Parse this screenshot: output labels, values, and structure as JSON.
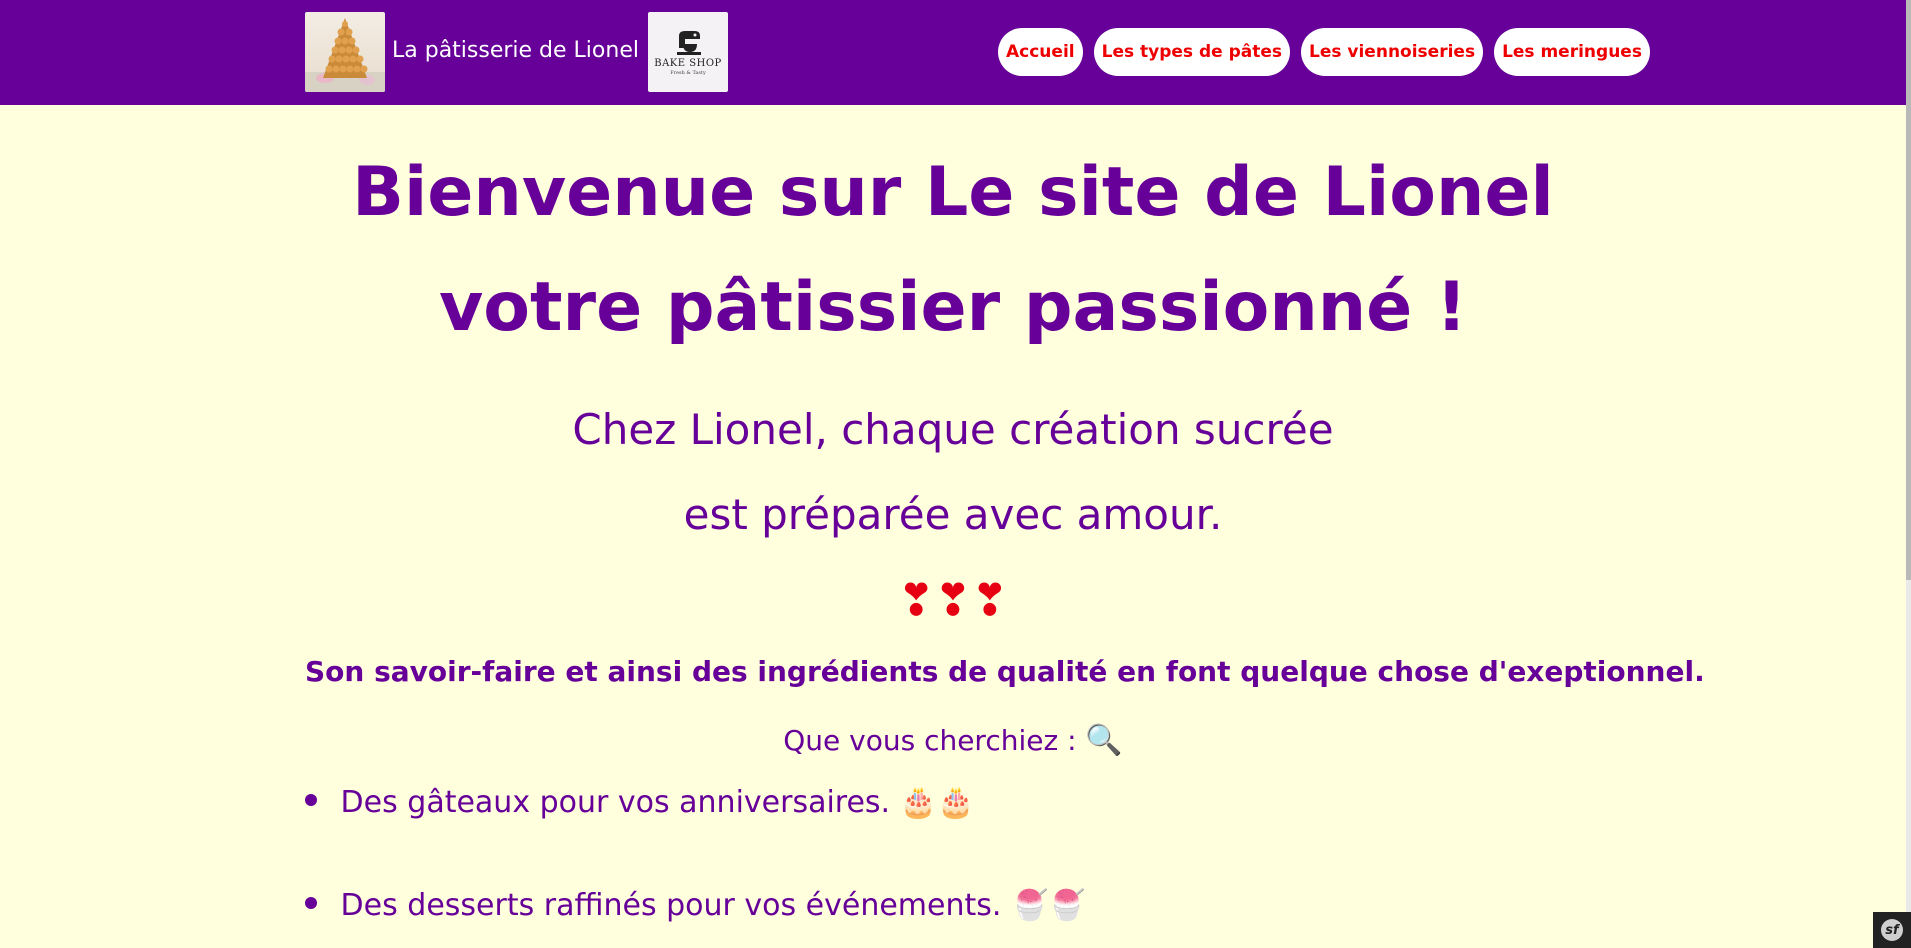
{
  "header": {
    "brand_title": "La pâtisserie de Lionel",
    "logo_text": "BAKE SHOP",
    "logo_subtext": "Fresh & Tasty",
    "nav": [
      {
        "label": "Accueil"
      },
      {
        "label": "Les types de pâtes"
      },
      {
        "label": "Les viennoiseries"
      },
      {
        "label": "Les meringues"
      }
    ]
  },
  "main": {
    "title_line1": "Bienvenue sur Le site de Lionel",
    "title_line2": "votre pâtissier passionné !",
    "lead_line1": "Chez Lionel, chaque création sucrée",
    "lead_line2": "est préparée avec amour.",
    "hearts": "❣❣❣",
    "strong_text": "Son savoir-faire et ainsi des ingrédients de qualité en font quelque chose d'exeptionnel.",
    "search_text": "Que vous cherchiez :",
    "search_emoji": "🔍",
    "list": [
      {
        "text": "Des gâteaux pour vos anniversaires.",
        "emoji": "🎂🎂"
      },
      {
        "text": "Des desserts raffinés pour vos événements.",
        "emoji": "🍧🍧"
      }
    ]
  },
  "colors": {
    "navbar": "#660099",
    "background": "#ffffdd",
    "text": "#660099",
    "nav_link": "#ee0000"
  },
  "toolbar": {
    "logo_text": "sf"
  }
}
